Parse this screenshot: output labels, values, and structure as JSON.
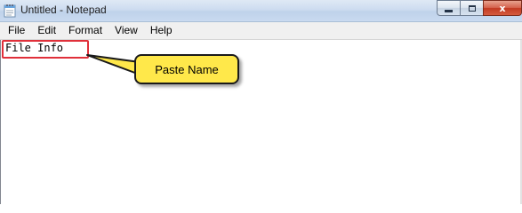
{
  "window": {
    "title": "Untitled - Notepad",
    "icon": "notepad-icon"
  },
  "caption_buttons": {
    "minimize_icon": "minimize-icon",
    "maximize_icon": "maximize-icon",
    "close_icon": "close-icon",
    "close_glyph": "x"
  },
  "menu": {
    "items": [
      "File",
      "Edit",
      "Format",
      "View",
      "Help"
    ]
  },
  "editor": {
    "content": "File Info"
  },
  "annotation": {
    "callout_text": "Paste Name",
    "highlight_color": "#e0303a",
    "callout_color": "#ffe84a"
  }
}
